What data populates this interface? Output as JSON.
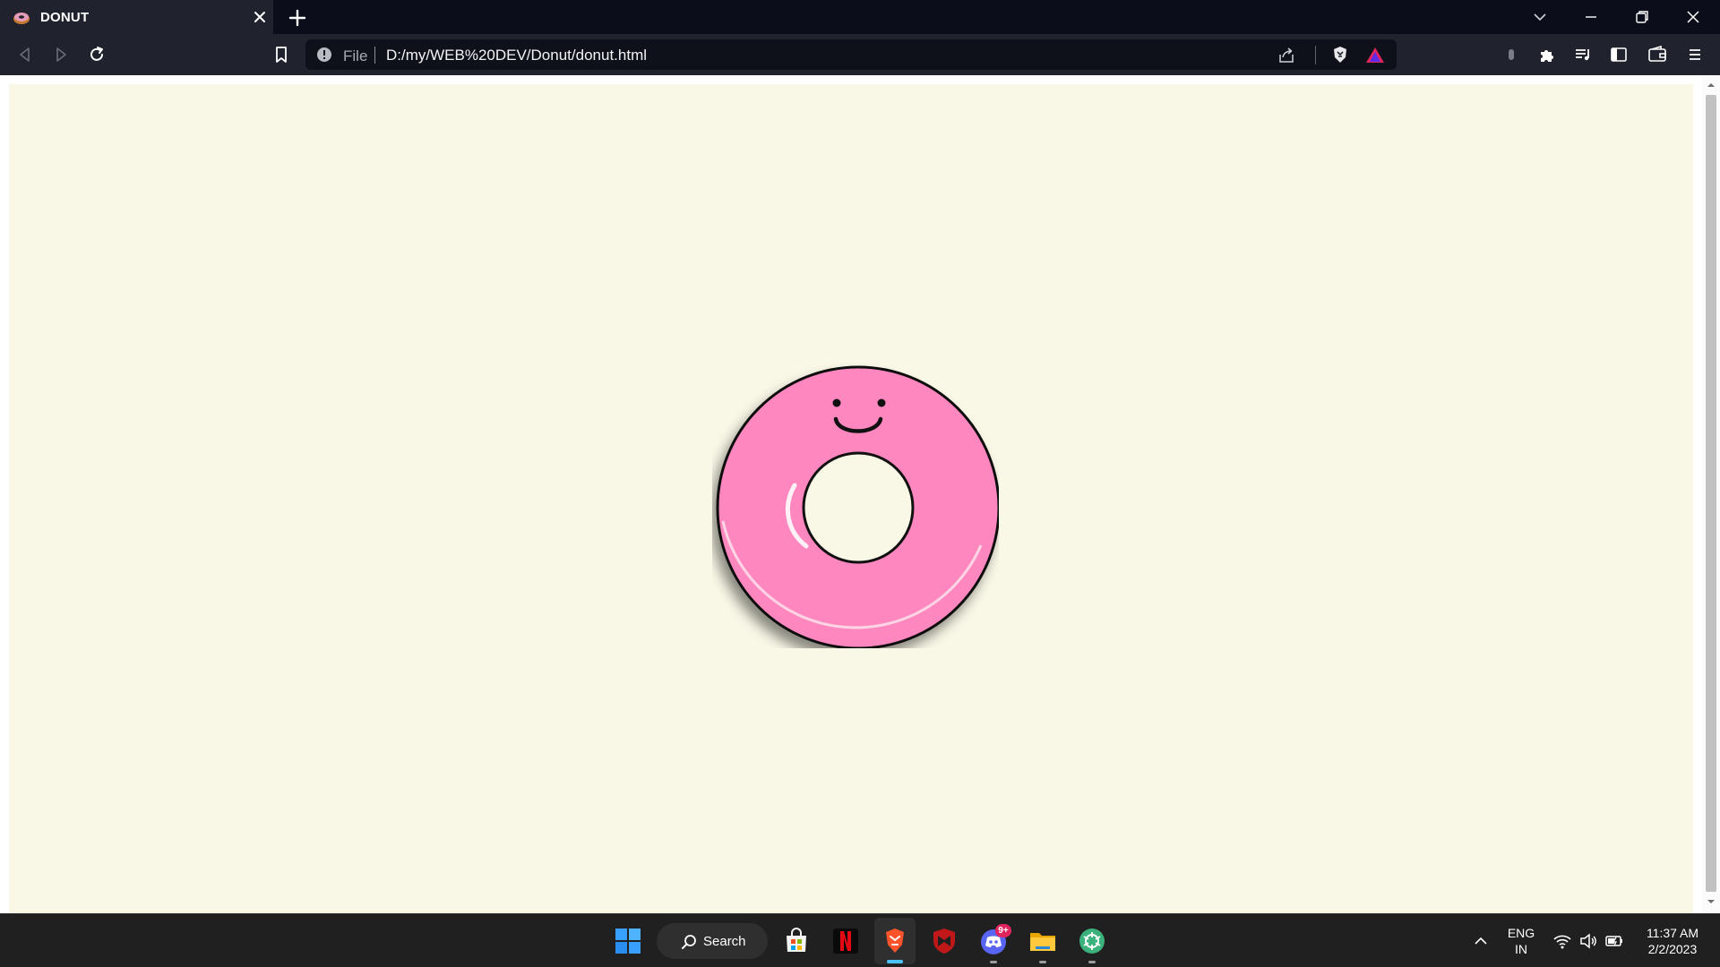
{
  "browser": {
    "tab": {
      "title": "DONUT",
      "favicon": "donut-icon"
    },
    "address_bar": {
      "scheme_label": "File",
      "url": "D:/my/WEB%20DEV/Donut/donut.html"
    }
  },
  "page": {
    "background_color": "#f9f7e6",
    "donut": {
      "frosting_color": "#ff87c0",
      "hole_color": "#f9f7e6",
      "outline_color": "#111111"
    }
  },
  "taskbar": {
    "search_label": "Search",
    "discord_badge": "9+",
    "language": {
      "line1": "ENG",
      "line2": "IN"
    },
    "clock": {
      "time": "11:37 AM",
      "date": "2/2/2023"
    }
  }
}
